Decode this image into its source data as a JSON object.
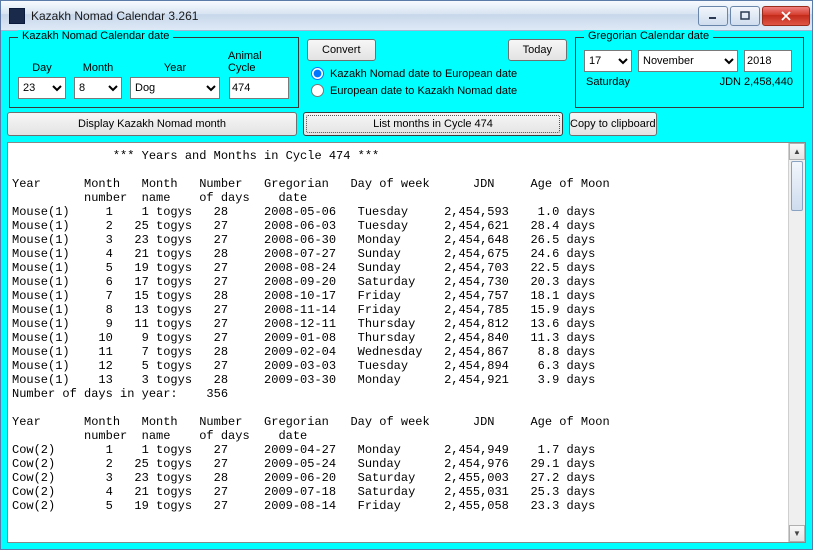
{
  "window": {
    "title": "Kazakh Nomad Calendar 3.261"
  },
  "kazakh": {
    "legend": "Kazakh Nomad Calendar date",
    "day_label": "Day",
    "month_label": "Month",
    "year_label": "Year",
    "cycle_label": "Animal Cycle",
    "day": "23",
    "month": "8",
    "year": "Dog",
    "cycle": "474"
  },
  "mid": {
    "convert": "Convert",
    "today": "Today",
    "r1": "Kazakh Nomad date to European date",
    "r2": "European date to Kazakh Nomad date"
  },
  "greg": {
    "legend": "Gregorian Calendar date",
    "day": "17",
    "month": "November",
    "year": "2018",
    "dow": "Saturday",
    "jdn": "JDN 2,458,440"
  },
  "buttons": {
    "b1": "Display Kazakh Nomad month",
    "b2": "List months in Cycle 474",
    "b3": "Copy to clipboard"
  },
  "output": "              *** Years and Months in Cycle 474 ***\n\nYear      Month   Month   Number   Gregorian   Day of week      JDN     Age of Moon\n          number  name    of days    date\nMouse(1)     1    1 togys   28     2008-05-06   Tuesday     2,454,593    1.0 days\nMouse(1)     2   25 togys   27     2008-06-03   Tuesday     2,454,621   28.4 days\nMouse(1)     3   23 togys   27     2008-06-30   Monday      2,454,648   26.5 days\nMouse(1)     4   21 togys   28     2008-07-27   Sunday      2,454,675   24.6 days\nMouse(1)     5   19 togys   27     2008-08-24   Sunday      2,454,703   22.5 days\nMouse(1)     6   17 togys   27     2008-09-20   Saturday    2,454,730   20.3 days\nMouse(1)     7   15 togys   28     2008-10-17   Friday      2,454,757   18.1 days\nMouse(1)     8   13 togys   27     2008-11-14   Friday      2,454,785   15.9 days\nMouse(1)     9   11 togys   27     2008-12-11   Thursday    2,454,812   13.6 days\nMouse(1)    10    9 togys   27     2009-01-08   Thursday    2,454,840   11.3 days\nMouse(1)    11    7 togys   28     2009-02-04   Wednesday   2,454,867    8.8 days\nMouse(1)    12    5 togys   27     2009-03-03   Tuesday     2,454,894    6.3 days\nMouse(1)    13    3 togys   28     2009-03-30   Monday      2,454,921    3.9 days\nNumber of days in year:    356\n\nYear      Month   Month   Number   Gregorian   Day of week      JDN     Age of Moon\n          number  name    of days    date\nCow(2)       1    1 togys   27     2009-04-27   Monday      2,454,949    1.7 days\nCow(2)       2   25 togys   27     2009-05-24   Sunday      2,454,976   29.1 days\nCow(2)       3   23 togys   28     2009-06-20   Saturday    2,455,003   27.2 days\nCow(2)       4   21 togys   27     2009-07-18   Saturday    2,455,031   25.3 days\nCow(2)       5   19 togys   27     2009-08-14   Friday      2,455,058   23.3 days"
}
